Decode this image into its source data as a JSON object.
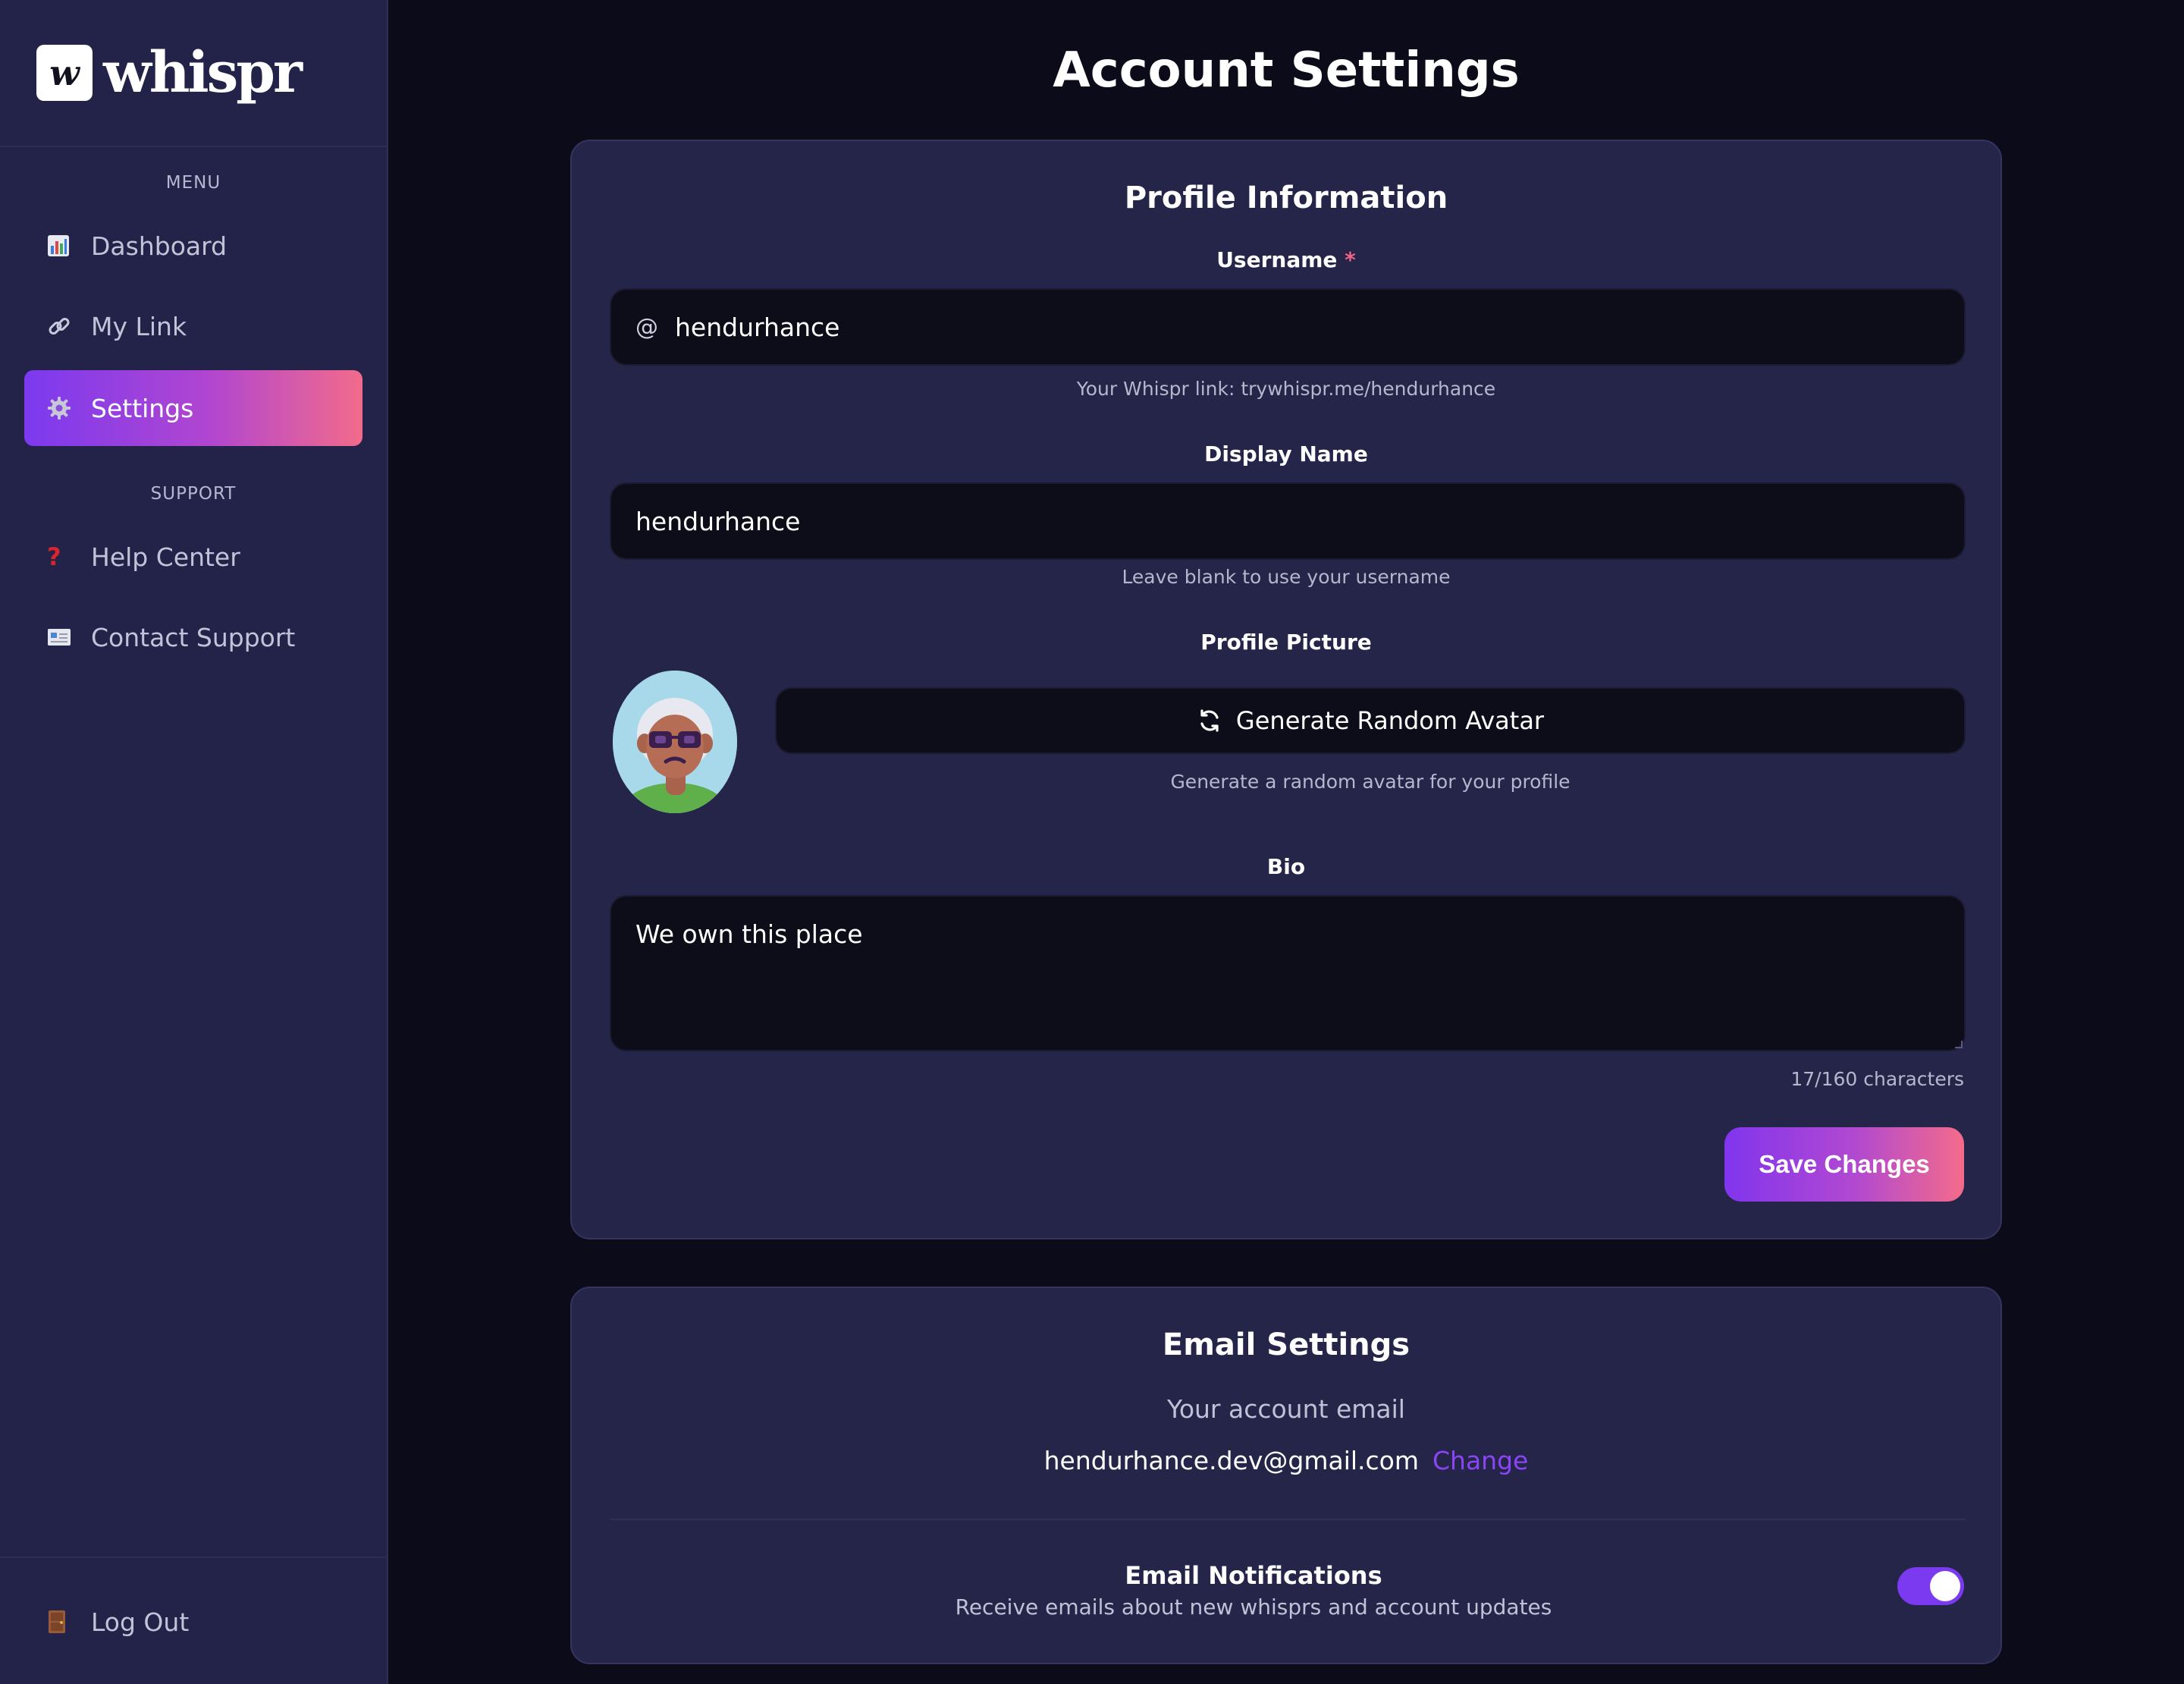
{
  "brand": {
    "logo_letter": "w",
    "name": "whispr"
  },
  "sidebar": {
    "menu_label": "MENU",
    "support_label": "SUPPORT",
    "items": [
      {
        "label": "Dashboard",
        "icon": "bar-chart-icon"
      },
      {
        "label": "My Link",
        "icon": "link-icon"
      },
      {
        "label": "Settings",
        "icon": "gear-icon",
        "active": true
      },
      {
        "label": "Help Center",
        "icon": "question-icon"
      },
      {
        "label": "Contact Support",
        "icon": "envelope-icon"
      }
    ],
    "logout_label": "Log Out"
  },
  "page": {
    "title": "Account Settings"
  },
  "profile": {
    "title": "Profile Information",
    "username_label": "Username",
    "required_mark": "*",
    "username_prefix": "@",
    "username_value": "hendurhance",
    "username_hint": "Your Whispr link: trywhispr.me/hendurhance",
    "display_name_label": "Display Name",
    "display_name_value": "hendurhance",
    "display_name_hint": "Leave blank to use your username",
    "picture_label": "Profile Picture",
    "generate_avatar_label": "Generate Random Avatar",
    "generate_avatar_hint": "Generate a random avatar for your profile",
    "bio_label": "Bio",
    "bio_value": "We own this place",
    "bio_counter": "17/160 characters",
    "save_label": "Save Changes"
  },
  "email": {
    "title": "Email Settings",
    "subtitle": "Your account email",
    "address": "hendurhance.dev@gmail.com",
    "change_label": "Change",
    "notifications_title": "Email Notifications",
    "notifications_desc": "Receive emails about new whisprs and account updates",
    "notifications_enabled": true
  },
  "colors": {
    "accent_purple": "#7b3aef",
    "accent_pink": "#f26b8b",
    "link": "#8b45f5",
    "required": "#f06488"
  }
}
